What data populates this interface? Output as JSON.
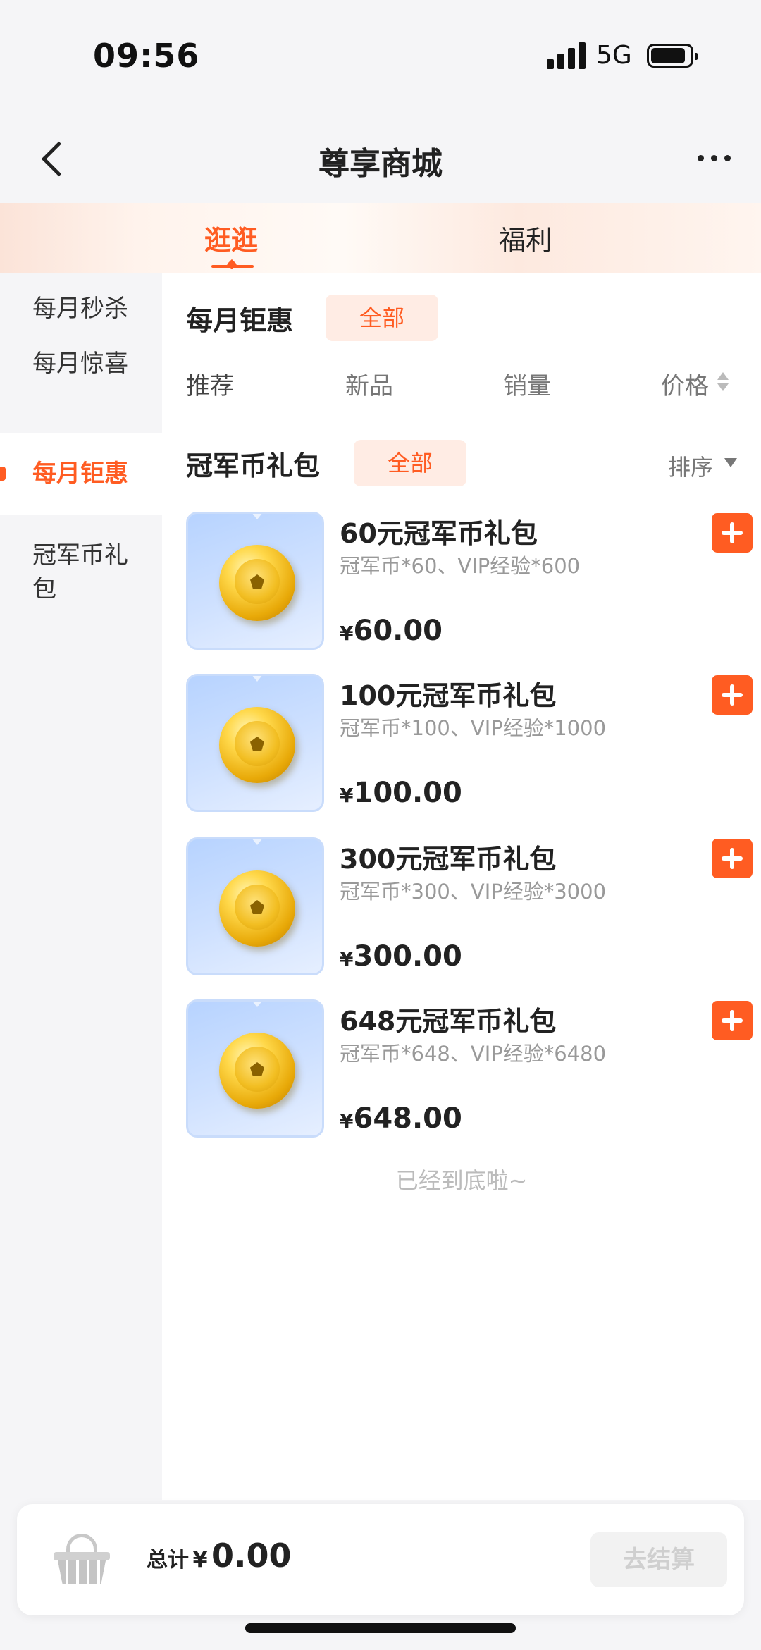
{
  "status_bar": {
    "time": "09:56",
    "network": "5G"
  },
  "nav": {
    "title": "尊享商城"
  },
  "tabs": [
    {
      "label": "逛逛",
      "active": true
    },
    {
      "label": "福利",
      "active": false
    }
  ],
  "sidebar": {
    "items": [
      {
        "label": "每月秒杀",
        "active": false
      },
      {
        "label": "每月惊喜",
        "active": false
      },
      {
        "label": "每月钜惠",
        "active": true
      },
      {
        "label": "冠军币礼包",
        "active": false
      }
    ]
  },
  "section": {
    "title": "每月钜惠",
    "chip": "全部",
    "filters": [
      "推荐",
      "新品",
      "销量",
      "价格"
    ]
  },
  "category": {
    "title": "冠军币礼包",
    "chip": "全部",
    "sort_label": "排序"
  },
  "products": [
    {
      "name": "60元冠军币礼包",
      "desc": "冠军币*60、VIP经验*600",
      "currency": "¥",
      "price": "60.00"
    },
    {
      "name": "100元冠军币礼包",
      "desc": "冠军币*100、VIP经验*1000",
      "currency": "¥",
      "price": "100.00"
    },
    {
      "name": "300元冠军币礼包",
      "desc": "冠军币*300、VIP经验*3000",
      "currency": "¥",
      "price": "300.00"
    },
    {
      "name": "648元冠军币礼包",
      "desc": "冠军币*648、VIP经验*6480",
      "currency": "¥",
      "price": "648.00"
    }
  ],
  "end_note": "已经到底啦~",
  "cart": {
    "total_label": "总计",
    "currency": "¥",
    "total": "0.00",
    "checkout_label": "去结算"
  },
  "colors": {
    "accent": "#ff5c22",
    "chip_bg": "#ffece4",
    "sidebar_bg": "#f5f5f7"
  }
}
